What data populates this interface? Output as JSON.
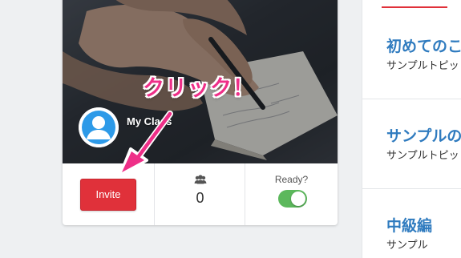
{
  "class_card": {
    "name": "My Class",
    "invite_label": "Invite",
    "members_icon": "users-icon",
    "member_count": "0",
    "ready_label": "Ready?",
    "ready_enabled": true
  },
  "sidebar": {
    "items": [
      {
        "title": "初めてのこ",
        "subtitle": "サンプルトピッ"
      },
      {
        "title": "サンプルの",
        "subtitle": "サンプルトピッ"
      },
      {
        "title": "中級編",
        "subtitle": "サンプル"
      }
    ]
  },
  "annotation": {
    "text": "クリック！"
  },
  "colors": {
    "invite_button": "#e0313a",
    "toggle_on": "#5cb85c",
    "annotation": "#ee2f88",
    "topic_title": "#2f7bbf",
    "accent": "#e0313a"
  }
}
